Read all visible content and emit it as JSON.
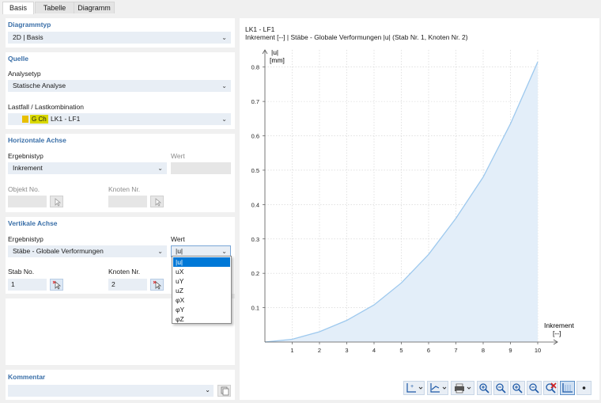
{
  "tabs": [
    "Basis",
    "Tabelle",
    "Diagramm"
  ],
  "diagrammtyp": {
    "title": "Diagrammtyp",
    "value": "2D | Basis"
  },
  "quelle": {
    "title": "Quelle",
    "analysetyp_label": "Analysetyp",
    "analysetyp_value": "Statische Analyse",
    "lastfall_label": "Lastfall / Lastkombination",
    "lastfall_tag": "G Ch",
    "lastfall_value": "LK1 - LF1",
    "tag_color": "#d9d900"
  },
  "horizontale_achse": {
    "title": "Horizontale Achse",
    "ergebnistyp_label": "Ergebnistyp",
    "ergebnistyp_value": "Inkrement",
    "wert_label": "Wert",
    "objekt_label": "Objekt No.",
    "knoten_label": "Knoten Nr."
  },
  "vertikale_achse": {
    "title": "Vertikale Achse",
    "ergebnistyp_label": "Ergebnistyp",
    "ergebnistyp_value": "Stäbe - Globale Verformungen",
    "wert_label": "Wert",
    "wert_value": "|u|",
    "stab_label": "Stab No.",
    "stab_value": "1",
    "knoten_label": "Knoten Nr.",
    "knoten_value": "2",
    "options": [
      "|u|",
      "uX",
      "uY",
      "uZ",
      "φX",
      "φY",
      "φZ"
    ]
  },
  "kommentar": {
    "title": "Kommentar",
    "value": ""
  },
  "chart_data": {
    "type": "area",
    "title": "LK1 - LF1",
    "subtitle": "Inkrement [--] | Stäbe - Globale Verformungen |u| (Stab Nr. 1, Knoten Nr. 2)",
    "ylabel": "|u|",
    "yunit": "[mm]",
    "xlabel": "Inkrement",
    "xunit": "[--]",
    "x": [
      0,
      1,
      2,
      3,
      4,
      5,
      6,
      7,
      8,
      9,
      10
    ],
    "y": [
      0,
      0.008,
      0.03,
      0.063,
      0.108,
      0.172,
      0.255,
      0.36,
      0.48,
      0.635,
      0.815
    ],
    "xlim": [
      0,
      10
    ],
    "ylim": [
      0,
      0.85
    ],
    "xticks": [
      1,
      2,
      3,
      4,
      5,
      6,
      7,
      8,
      9,
      10
    ],
    "yticks": [
      0.1,
      0.2,
      0.3,
      0.4,
      0.5,
      0.6,
      0.7,
      0.8
    ],
    "grid": true,
    "line_color": "#9ec9ee",
    "fill_color": "#e3eef9"
  },
  "toolbar": [
    "axis-settings-icon",
    "chart-options-icon",
    "print-icon",
    "zoom-in-icon",
    "zoom-out-icon",
    "zoom-x-icon",
    "zoom-y-icon",
    "reset-zoom-icon",
    "grid-toggle-icon",
    "points-icon"
  ]
}
